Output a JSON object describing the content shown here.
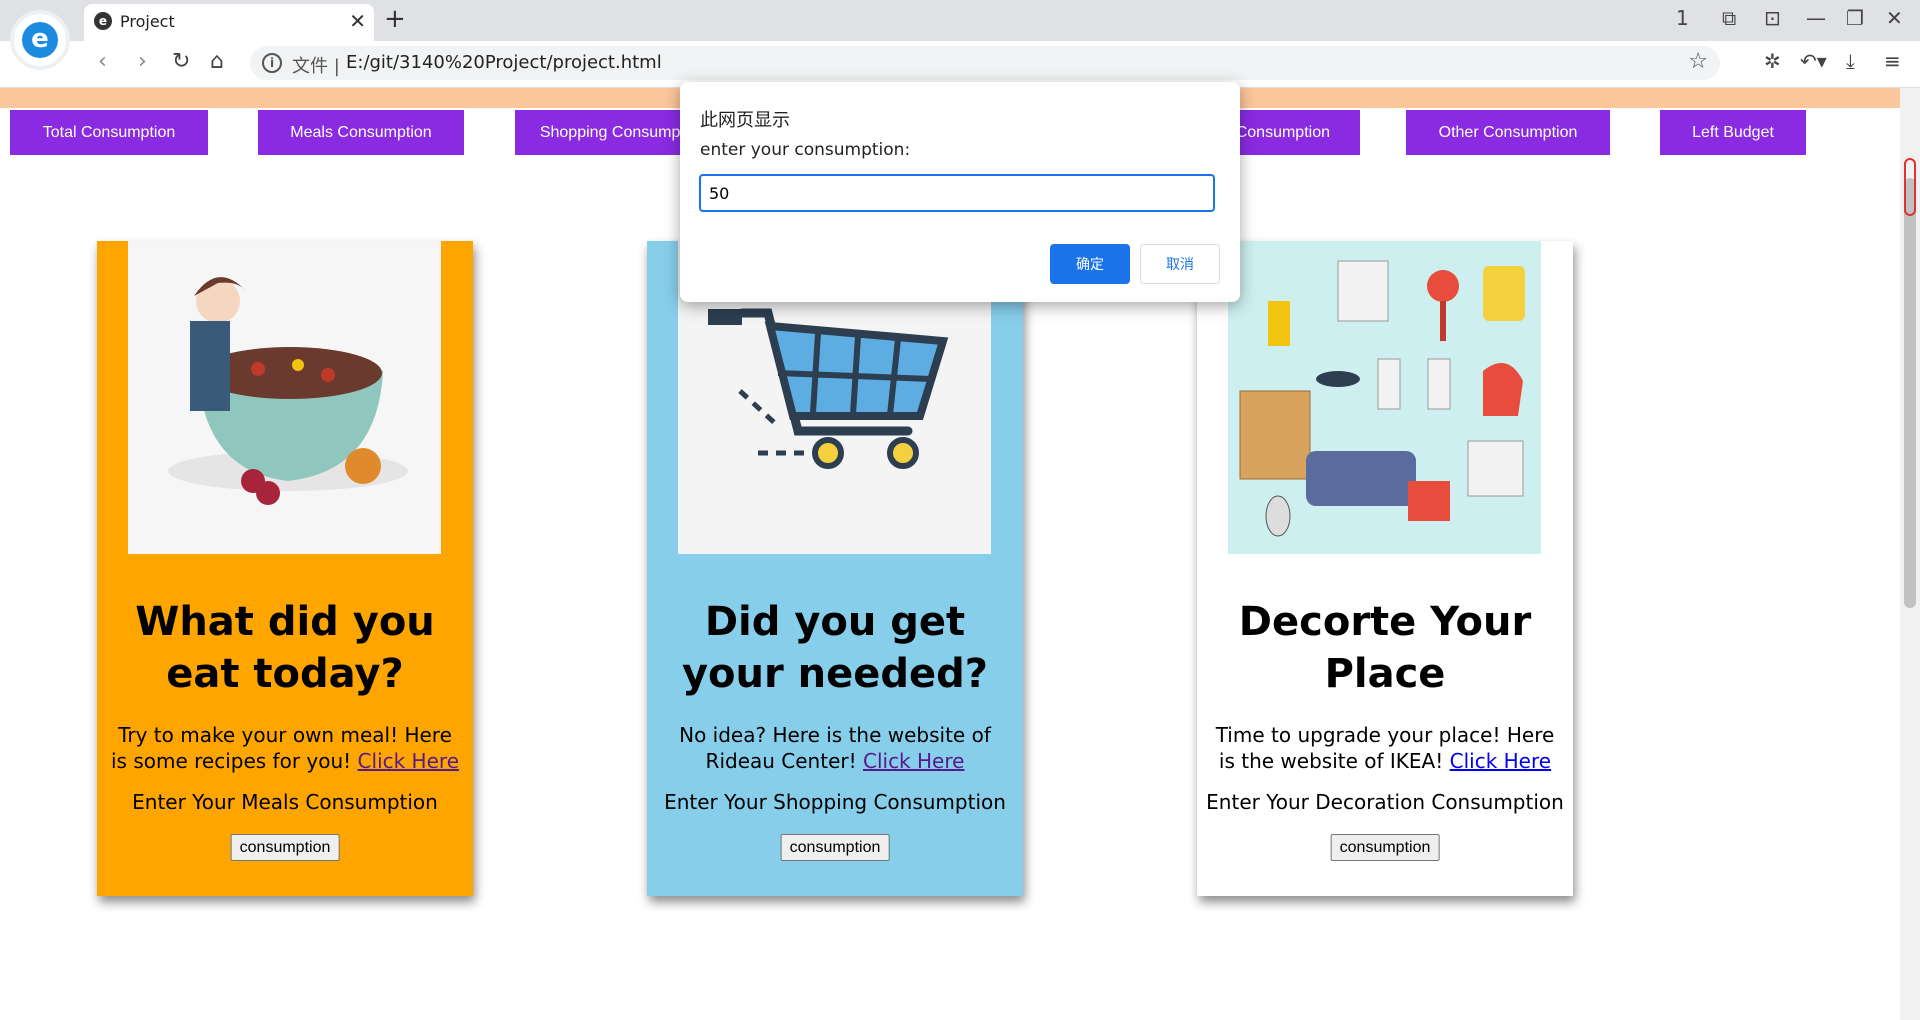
{
  "browser": {
    "tab_title": "Project",
    "tab_close": "✕",
    "new_tab": "+",
    "address_prefix": "文件 |",
    "address_url": "E:/git/3140%20Project/project.html",
    "window_controls": [
      "1",
      "⧉",
      "⊡",
      "—",
      "❐",
      "✕"
    ]
  },
  "nav": {
    "total": "Total Consumption",
    "meals": "Meals Consumption",
    "shopping": "Shopping Consumption",
    "decoration": "Decoration Consumption",
    "other": "Other Consumption",
    "budget": "Left Budget",
    "accent_color": "#8a2be2"
  },
  "cards": [
    {
      "title": "What did you eat today?",
      "desc": "Try to make your own meal! Here is some recipes for you!",
      "link": "Click Here",
      "enter": "Enter Your Meals Consumption",
      "button": "consumption",
      "bg": "#ffa500"
    },
    {
      "title": "Did you get your needed?",
      "desc": "No idea? Here is the website of Rideau Center!",
      "link": "Click Here",
      "enter": "Enter Your Shopping Consumption",
      "button": "consumption",
      "bg": "#87ceeb"
    },
    {
      "title": "Decorte Your Place",
      "desc": "Time to upgrade your place! Here is the website of IKEA!",
      "link": "Click Here",
      "enter": "Enter Your Decoration Consumption",
      "button": "consumption",
      "bg": "#ffffff"
    }
  ],
  "dialog": {
    "title": "此网页显示",
    "message": "enter your consumption:",
    "value": "50",
    "ok": "确定",
    "cancel": "取消"
  }
}
